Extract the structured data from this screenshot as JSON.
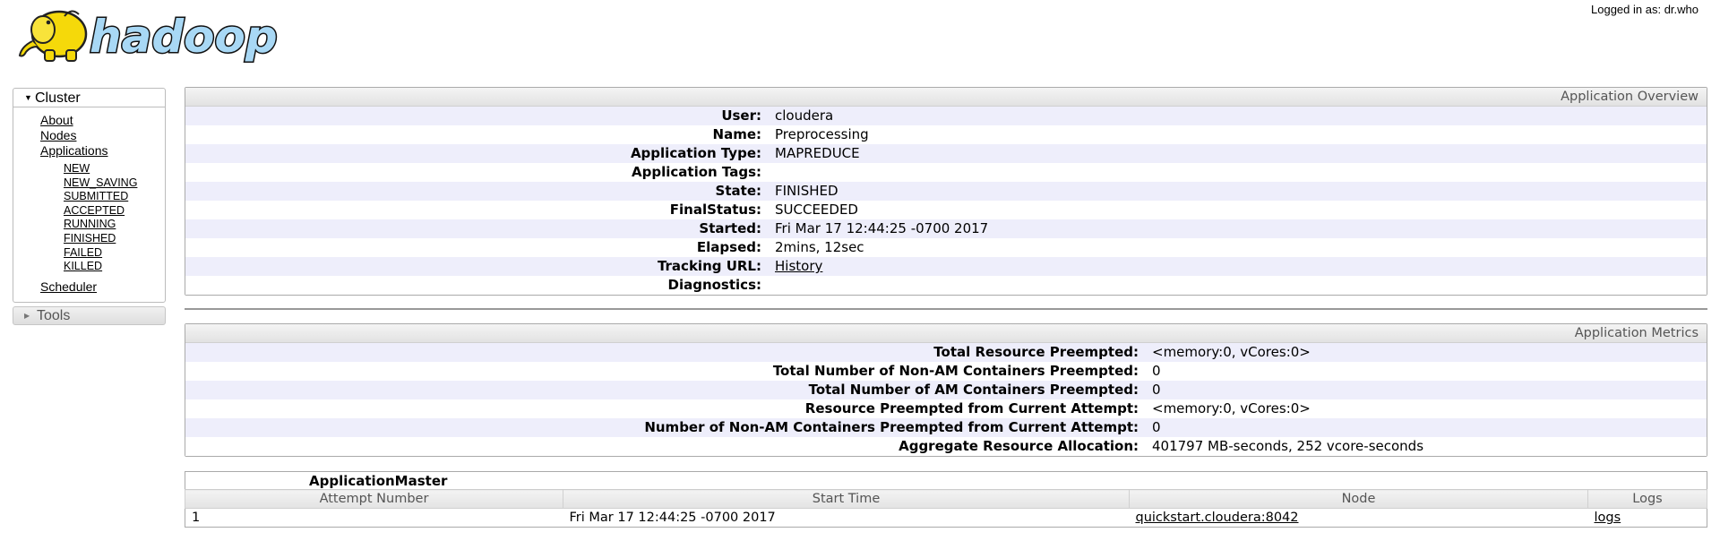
{
  "header": {
    "logo_text": "hadoop",
    "logged_in": "Logged in as: dr.who"
  },
  "nav": {
    "cluster_label": "Cluster",
    "items": [
      "About",
      "Nodes",
      "Applications"
    ],
    "app_states": [
      "NEW",
      "NEW_SAVING",
      "SUBMITTED",
      "ACCEPTED",
      "RUNNING",
      "FINISHED",
      "FAILED",
      "KILLED"
    ],
    "scheduler": "Scheduler",
    "tools_label": "Tools"
  },
  "overview": {
    "title": "Application Overview",
    "rows": [
      {
        "k": "User:",
        "v": "cloudera"
      },
      {
        "k": "Name:",
        "v": "Preprocessing"
      },
      {
        "k": "Application Type:",
        "v": "MAPREDUCE"
      },
      {
        "k": "Application Tags:",
        "v": ""
      },
      {
        "k": "State:",
        "v": "FINISHED"
      },
      {
        "k": "FinalStatus:",
        "v": "SUCCEEDED"
      },
      {
        "k": "Started:",
        "v": "Fri Mar 17 12:44:25 -0700 2017"
      },
      {
        "k": "Elapsed:",
        "v": "2mins, 12sec"
      },
      {
        "k": "Tracking URL:",
        "v": "History"
      },
      {
        "k": "Diagnostics:",
        "v": ""
      }
    ]
  },
  "metrics": {
    "title": "Application Metrics",
    "rows": [
      {
        "k": "Total Resource Preempted:",
        "v": "<memory:0, vCores:0>"
      },
      {
        "k": "Total Number of Non-AM Containers Preempted:",
        "v": "0"
      },
      {
        "k": "Total Number of AM Containers Preempted:",
        "v": "0"
      },
      {
        "k": "Resource Preempted from Current Attempt:",
        "v": "<memory:0, vCores:0>"
      },
      {
        "k": "Number of Non-AM Containers Preempted from Current Attempt:",
        "v": "0"
      },
      {
        "k": "Aggregate Resource Allocation:",
        "v": "401797 MB-seconds, 252 vcore-seconds"
      }
    ]
  },
  "attempts": {
    "caption": "ApplicationMaster",
    "columns": [
      "Attempt Number",
      "Start Time",
      "Node",
      "Logs"
    ],
    "rows": [
      {
        "attempt": "1",
        "start": "Fri Mar 17 12:44:25 -0700 2017",
        "node": "quickstart.cloudera:8042",
        "logs": "logs"
      }
    ]
  }
}
